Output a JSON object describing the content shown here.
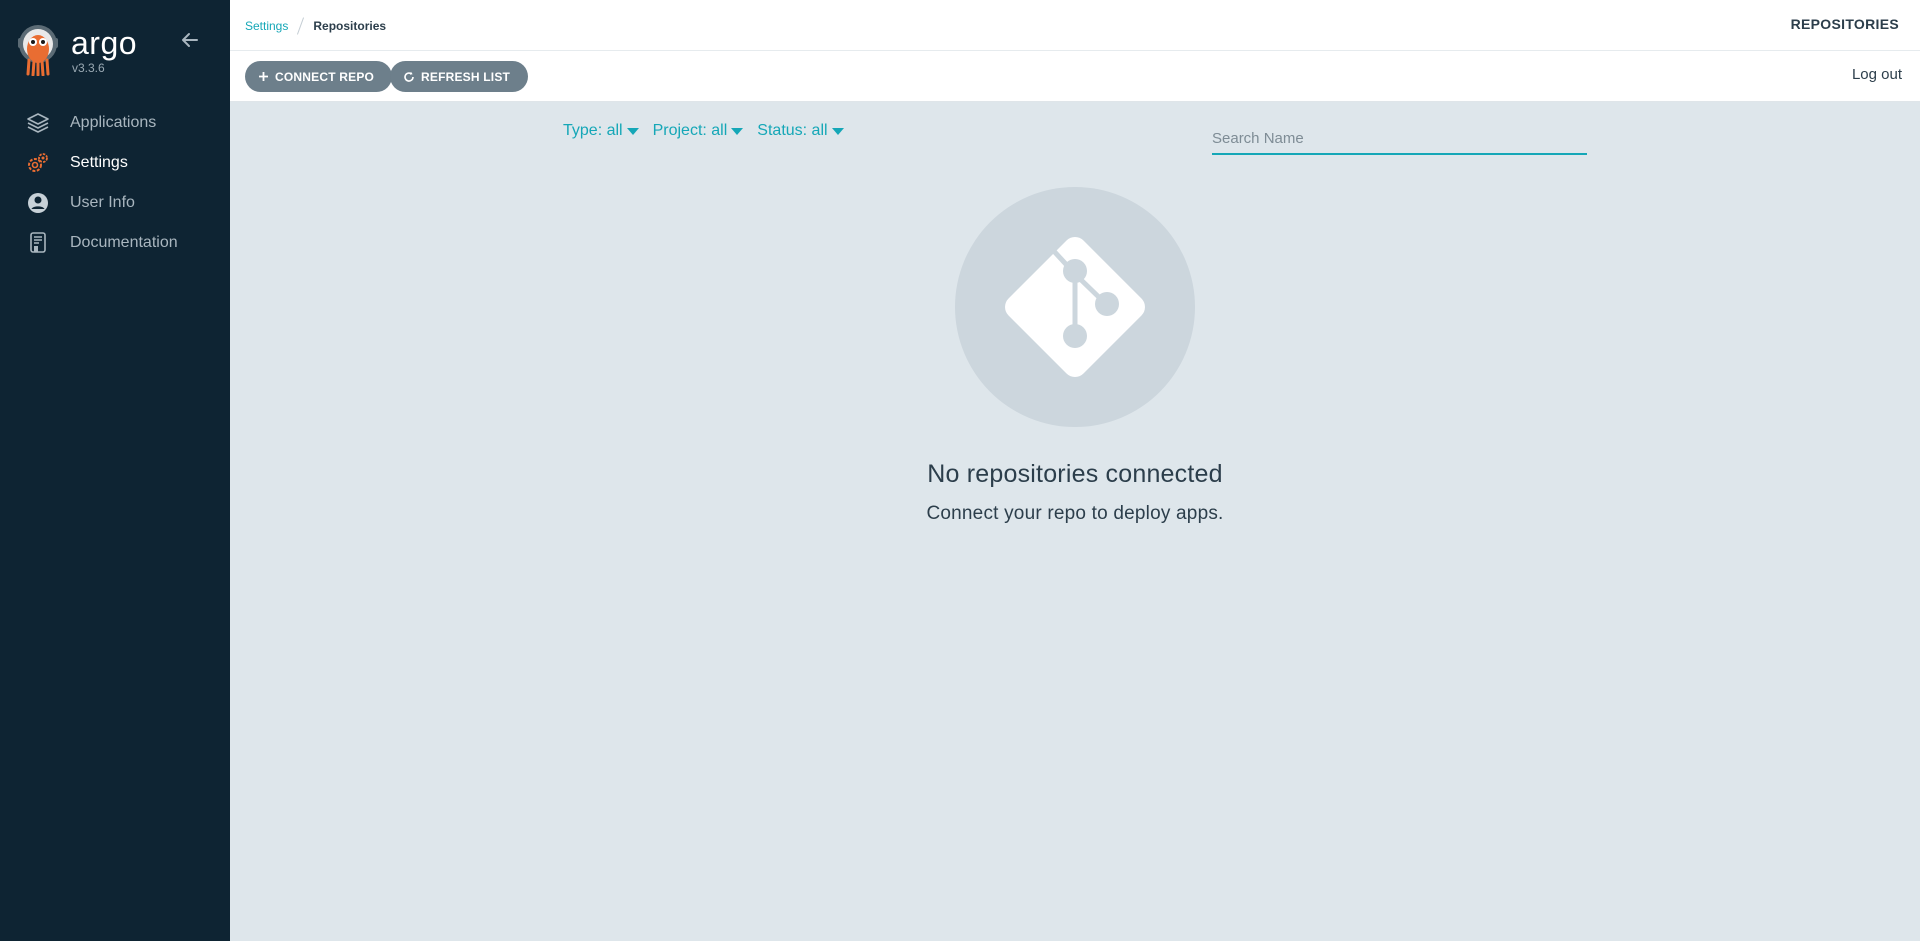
{
  "sidebar": {
    "brand": {
      "name": "argo",
      "version": "v3.3.6"
    },
    "items": [
      {
        "label": "Applications",
        "icon": "layers-icon",
        "active": false
      },
      {
        "label": "Settings",
        "icon": "gears-icon",
        "active": true
      },
      {
        "label": "User Info",
        "icon": "user-circle-icon",
        "active": false
      },
      {
        "label": "Documentation",
        "icon": "book-icon",
        "active": false
      }
    ]
  },
  "header": {
    "breadcrumb": {
      "parent": "Settings",
      "current": "Repositories"
    },
    "title": "REPOSITORIES"
  },
  "toolbar": {
    "connect_label": "CONNECT REPO",
    "refresh_label": "REFRESH LIST",
    "logout_label": "Log out"
  },
  "filters": {
    "type": "Type: all",
    "project": "Project: all",
    "status": "Status: all"
  },
  "search": {
    "placeholder": "Search Name",
    "value": ""
  },
  "empty_state": {
    "title": "No repositories connected",
    "subtitle": "Connect your repo to deploy apps."
  },
  "colors": {
    "sidebar_bg": "#0e2433",
    "accent": "#15a7b7",
    "button_bg": "#6d7f8b",
    "content_bg": "#dee6eb"
  }
}
